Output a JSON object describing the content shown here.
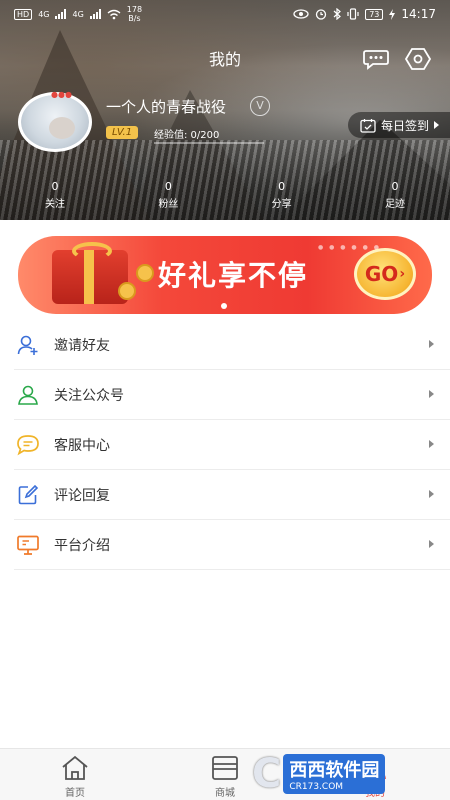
{
  "status_bar": {
    "hd": "HD",
    "network_1": "4G",
    "network_2": "4G",
    "speed_value": "178",
    "speed_unit": "B/s",
    "battery": "73",
    "time": "14:17"
  },
  "header": {
    "title": "我的",
    "message_icon": "chat-bubble-icon",
    "settings_icon": "hexagon-settings-icon"
  },
  "profile": {
    "username": "一个人的青春战役",
    "vip_icon": "V",
    "level": "LV.1",
    "exp_label": "经验值: 0/200",
    "checkin_label": "每日签到"
  },
  "stats": [
    {
      "value": "0",
      "label": "关注"
    },
    {
      "value": "0",
      "label": "粉丝"
    },
    {
      "value": "0",
      "label": "分享"
    },
    {
      "value": "0",
      "label": "足迹"
    }
  ],
  "banner": {
    "text": "好礼享不停",
    "go_label": "GO"
  },
  "menu": [
    {
      "label": "邀请好友",
      "icon": "invite-user-icon",
      "color": "#3b6fd8"
    },
    {
      "label": "关注公众号",
      "icon": "user-follow-icon",
      "color": "#2aa84a"
    },
    {
      "label": "客服中心",
      "icon": "chat-service-icon",
      "color": "#f0b429"
    },
    {
      "label": "评论回复",
      "icon": "edit-comment-icon",
      "color": "#3b6fd8"
    },
    {
      "label": "平台介绍",
      "icon": "monitor-icon",
      "color": "#f07a2a"
    }
  ],
  "bottom_nav": [
    {
      "label": "首页",
      "icon": "home-icon"
    },
    {
      "label": "商城",
      "icon": "store-icon"
    },
    {
      "label": "我的",
      "icon": "profile-icon"
    }
  ],
  "watermark": {
    "brand": "西西软件园",
    "domain": "CR173.COM"
  }
}
